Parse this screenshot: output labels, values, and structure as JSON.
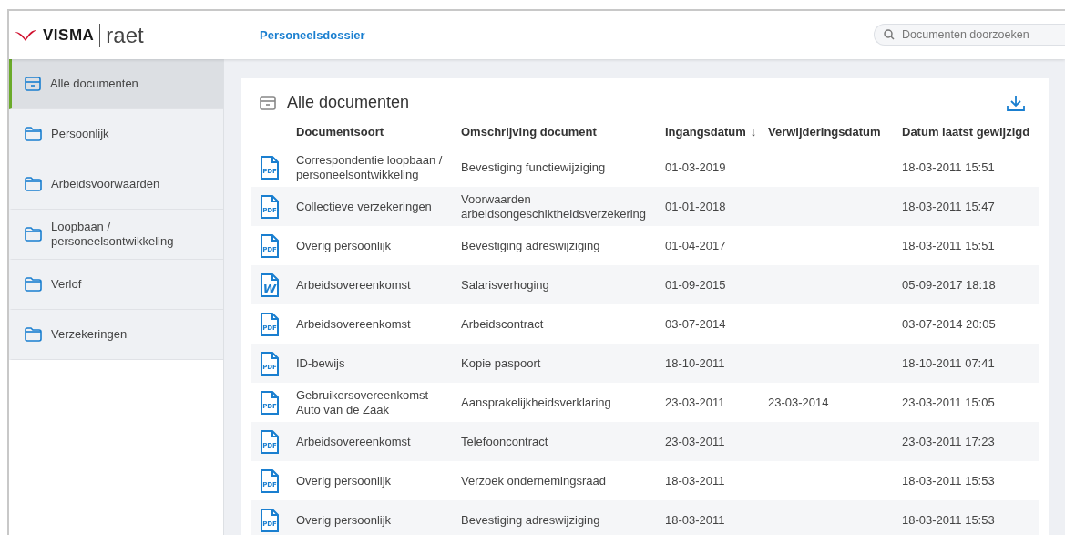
{
  "header": {
    "logo_brand": "VISMA",
    "logo_product": "raet",
    "title": "Personeelsdossier",
    "search": {
      "placeholder": "Documenten doorzoeken"
    }
  },
  "sidebar": {
    "items": [
      {
        "label": "Alle documenten",
        "kind": "archive",
        "selected": true
      },
      {
        "label": "Persoonlijk",
        "kind": "folder",
        "selected": false
      },
      {
        "label": "Arbeidsvoorwaarden",
        "kind": "folder",
        "selected": false
      },
      {
        "label": "Loopbaan / personeelsontwikkeling",
        "kind": "folder",
        "selected": false
      },
      {
        "label": "Verlof",
        "kind": "folder",
        "selected": false
      },
      {
        "label": "Verzekeringen",
        "kind": "folder",
        "selected": false
      }
    ]
  },
  "panel": {
    "title": "Alle documenten",
    "columns": [
      {
        "label": "Documentsoort"
      },
      {
        "label": "Omschrijving document"
      },
      {
        "label": "Ingangsdatum",
        "sort_indicator": "↓"
      },
      {
        "label": "Verwijderingsdatum"
      },
      {
        "label": "Datum laatst gewijzigd"
      }
    ],
    "rows": [
      {
        "kind": "pdf",
        "icon_text": "PDF",
        "cells": [
          "Correspondentie loopbaan / personeelsontwikkeling",
          "Bevestiging functiewijziging",
          "01-03-2019",
          "",
          "18-03-2011 15:51"
        ]
      },
      {
        "kind": "pdf",
        "icon_text": "PDF",
        "cells": [
          "Collectieve verzekeringen",
          "Voorwaarden arbeidsongeschiktheidsverzekering",
          "01-01-2018",
          "",
          "18-03-2011 15:47"
        ]
      },
      {
        "kind": "pdf",
        "icon_text": "PDF",
        "cells": [
          "Overig persoonlijk",
          "Bevestiging adreswijziging",
          "01-04-2017",
          "",
          "18-03-2011 15:51"
        ]
      },
      {
        "kind": "word",
        "icon_text": "W",
        "cells": [
          "Arbeidsovereenkomst",
          "Salarisverhoging",
          "01-09-2015",
          "",
          "05-09-2017 18:18"
        ]
      },
      {
        "kind": "pdf",
        "icon_text": "PDF",
        "cells": [
          "Arbeidsovereenkomst",
          "Arbeidscontract",
          "03-07-2014",
          "",
          "03-07-2014 20:05"
        ]
      },
      {
        "kind": "pdf",
        "icon_text": "PDF",
        "cells": [
          "ID-bewijs",
          "Kopie paspoort",
          "18-10-2011",
          "",
          "18-10-2011 07:41"
        ]
      },
      {
        "kind": "pdf",
        "icon_text": "PDF",
        "cells": [
          "Gebruikersovereenkomst Auto van de Zaak",
          "Aansprakelijkheidsverklaring",
          "23-03-2011",
          "23-03-2014",
          "23-03-2011 15:05"
        ]
      },
      {
        "kind": "pdf",
        "icon_text": "PDF",
        "cells": [
          "Arbeidsovereenkomst",
          "Telefooncontract",
          "23-03-2011",
          "",
          "23-03-2011 17:23"
        ]
      },
      {
        "kind": "pdf",
        "icon_text": "PDF",
        "cells": [
          "Overig persoonlijk",
          "Verzoek ondernemingsraad",
          "18-03-2011",
          "",
          "18-03-2011 15:53"
        ]
      },
      {
        "kind": "pdf",
        "icon_text": "PDF",
        "cells": [
          "Overig persoonlijk",
          "Bevestiging adreswijziging",
          "18-03-2011",
          "",
          "18-03-2011 15:53"
        ]
      }
    ]
  }
}
